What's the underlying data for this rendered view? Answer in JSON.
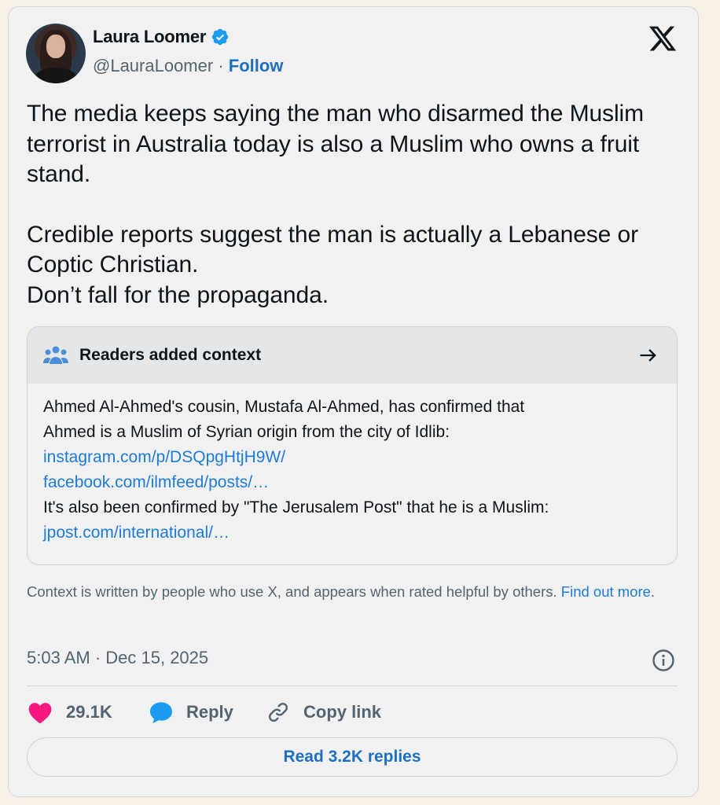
{
  "author": {
    "name": "Laura Loomer",
    "handle": "@LauraLoomer",
    "separator": " · ",
    "follow_label": "Follow",
    "verified_icon": "verified-badge-icon"
  },
  "tweet": {
    "paragraphs": [
      "The media keeps saying the man who disarmed the Muslim terrorist in Australia today is also a Muslim who owns a fruit stand.",
      "Credible reports suggest the man is actually a Lebanese or Coptic Christian.\nDon’t fall for the propaganda."
    ]
  },
  "community_note": {
    "title": "Readers added context",
    "line1": "Ahmed Al-Ahmed's cousin, Mustafa Al-Ahmed, has confirmed that",
    "line2": "Ahmed is a Muslim of Syrian origin from the city of Idlib:",
    "link1": "instagram.com/p/DSQpgHtjH9W/",
    "link2": "facebook.com/ilmfeed/posts/…",
    "line3": "It's also been confirmed by \"The Jerusalem Post\" that he is a Muslim:",
    "link3": "jpost.com/international/…"
  },
  "note_footer": {
    "text": "Context is written by people who use X, and appears when rated helpful by others.",
    "link": "Find out more",
    "period": "."
  },
  "timestamp": "5:03 AM · Dec 15, 2025",
  "actions": {
    "likes": "29.1K",
    "reply_label": "Reply",
    "copy_label": "Copy link"
  },
  "read_replies_label": "Read 3.2K replies",
  "colors": {
    "accent": "#1d6fc2",
    "link": "#1d7bd8",
    "like": "#f91880",
    "reply": "#1d9bf0",
    "verified": "#1d9bf0"
  }
}
